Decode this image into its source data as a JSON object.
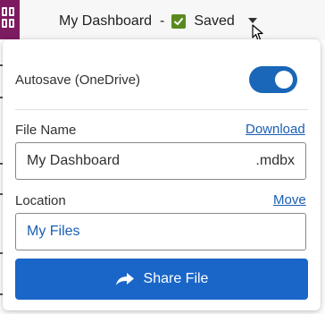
{
  "header": {
    "document_title": "My Dashboard",
    "separator": "-",
    "save_status": "Saved"
  },
  "panel": {
    "autosave": {
      "label": "Autosave (OneDrive)",
      "enabled": true
    },
    "file_name": {
      "label": "File Name",
      "download_link": "Download",
      "value": "My Dashboard",
      "extension": ".mdbx"
    },
    "location": {
      "label": "Location",
      "move_link": "Move",
      "value": "My Files"
    },
    "share_button": "Share File"
  },
  "colors": {
    "app_tile": "#7d1b61",
    "accent": "#1a66c8",
    "saved_check": "#5a8a1f",
    "link": "#1a5fb4"
  }
}
